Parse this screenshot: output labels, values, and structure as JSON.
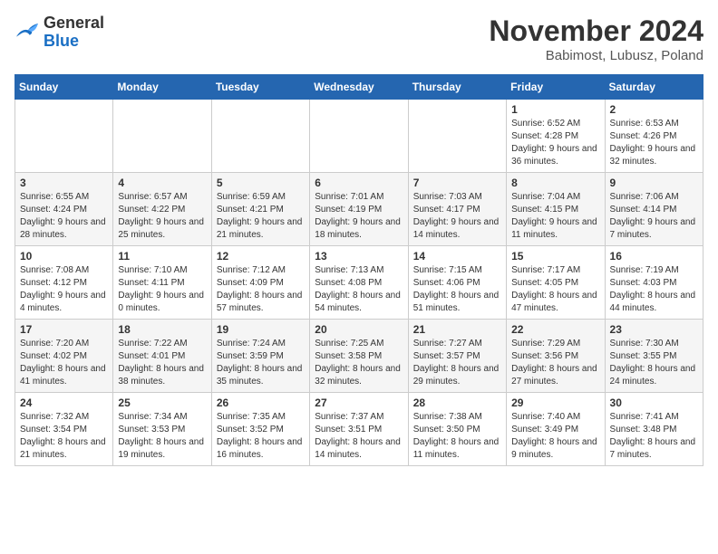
{
  "header": {
    "logo": {
      "general": "General",
      "blue": "Blue"
    },
    "title": "November 2024",
    "subtitle": "Babimost, Lubusz, Poland"
  },
  "days_of_week": [
    "Sunday",
    "Monday",
    "Tuesday",
    "Wednesday",
    "Thursday",
    "Friday",
    "Saturday"
  ],
  "weeks": [
    [
      {
        "day": "",
        "info": ""
      },
      {
        "day": "",
        "info": ""
      },
      {
        "day": "",
        "info": ""
      },
      {
        "day": "",
        "info": ""
      },
      {
        "day": "",
        "info": ""
      },
      {
        "day": "1",
        "info": "Sunrise: 6:52 AM\nSunset: 4:28 PM\nDaylight: 9 hours and 36 minutes."
      },
      {
        "day": "2",
        "info": "Sunrise: 6:53 AM\nSunset: 4:26 PM\nDaylight: 9 hours and 32 minutes."
      }
    ],
    [
      {
        "day": "3",
        "info": "Sunrise: 6:55 AM\nSunset: 4:24 PM\nDaylight: 9 hours and 28 minutes."
      },
      {
        "day": "4",
        "info": "Sunrise: 6:57 AM\nSunset: 4:22 PM\nDaylight: 9 hours and 25 minutes."
      },
      {
        "day": "5",
        "info": "Sunrise: 6:59 AM\nSunset: 4:21 PM\nDaylight: 9 hours and 21 minutes."
      },
      {
        "day": "6",
        "info": "Sunrise: 7:01 AM\nSunset: 4:19 PM\nDaylight: 9 hours and 18 minutes."
      },
      {
        "day": "7",
        "info": "Sunrise: 7:03 AM\nSunset: 4:17 PM\nDaylight: 9 hours and 14 minutes."
      },
      {
        "day": "8",
        "info": "Sunrise: 7:04 AM\nSunset: 4:15 PM\nDaylight: 9 hours and 11 minutes."
      },
      {
        "day": "9",
        "info": "Sunrise: 7:06 AM\nSunset: 4:14 PM\nDaylight: 9 hours and 7 minutes."
      }
    ],
    [
      {
        "day": "10",
        "info": "Sunrise: 7:08 AM\nSunset: 4:12 PM\nDaylight: 9 hours and 4 minutes."
      },
      {
        "day": "11",
        "info": "Sunrise: 7:10 AM\nSunset: 4:11 PM\nDaylight: 9 hours and 0 minutes."
      },
      {
        "day": "12",
        "info": "Sunrise: 7:12 AM\nSunset: 4:09 PM\nDaylight: 8 hours and 57 minutes."
      },
      {
        "day": "13",
        "info": "Sunrise: 7:13 AM\nSunset: 4:08 PM\nDaylight: 8 hours and 54 minutes."
      },
      {
        "day": "14",
        "info": "Sunrise: 7:15 AM\nSunset: 4:06 PM\nDaylight: 8 hours and 51 minutes."
      },
      {
        "day": "15",
        "info": "Sunrise: 7:17 AM\nSunset: 4:05 PM\nDaylight: 8 hours and 47 minutes."
      },
      {
        "day": "16",
        "info": "Sunrise: 7:19 AM\nSunset: 4:03 PM\nDaylight: 8 hours and 44 minutes."
      }
    ],
    [
      {
        "day": "17",
        "info": "Sunrise: 7:20 AM\nSunset: 4:02 PM\nDaylight: 8 hours and 41 minutes."
      },
      {
        "day": "18",
        "info": "Sunrise: 7:22 AM\nSunset: 4:01 PM\nDaylight: 8 hours and 38 minutes."
      },
      {
        "day": "19",
        "info": "Sunrise: 7:24 AM\nSunset: 3:59 PM\nDaylight: 8 hours and 35 minutes."
      },
      {
        "day": "20",
        "info": "Sunrise: 7:25 AM\nSunset: 3:58 PM\nDaylight: 8 hours and 32 minutes."
      },
      {
        "day": "21",
        "info": "Sunrise: 7:27 AM\nSunset: 3:57 PM\nDaylight: 8 hours and 29 minutes."
      },
      {
        "day": "22",
        "info": "Sunrise: 7:29 AM\nSunset: 3:56 PM\nDaylight: 8 hours and 27 minutes."
      },
      {
        "day": "23",
        "info": "Sunrise: 7:30 AM\nSunset: 3:55 PM\nDaylight: 8 hours and 24 minutes."
      }
    ],
    [
      {
        "day": "24",
        "info": "Sunrise: 7:32 AM\nSunset: 3:54 PM\nDaylight: 8 hours and 21 minutes."
      },
      {
        "day": "25",
        "info": "Sunrise: 7:34 AM\nSunset: 3:53 PM\nDaylight: 8 hours and 19 minutes."
      },
      {
        "day": "26",
        "info": "Sunrise: 7:35 AM\nSunset: 3:52 PM\nDaylight: 8 hours and 16 minutes."
      },
      {
        "day": "27",
        "info": "Sunrise: 7:37 AM\nSunset: 3:51 PM\nDaylight: 8 hours and 14 minutes."
      },
      {
        "day": "28",
        "info": "Sunrise: 7:38 AM\nSunset: 3:50 PM\nDaylight: 8 hours and 11 minutes."
      },
      {
        "day": "29",
        "info": "Sunrise: 7:40 AM\nSunset: 3:49 PM\nDaylight: 8 hours and 9 minutes."
      },
      {
        "day": "30",
        "info": "Sunrise: 7:41 AM\nSunset: 3:48 PM\nDaylight: 8 hours and 7 minutes."
      }
    ]
  ]
}
